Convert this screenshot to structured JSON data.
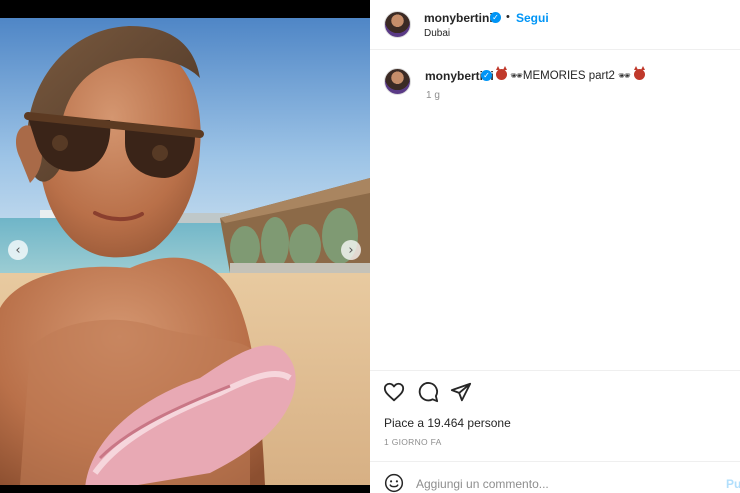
{
  "header": {
    "username": "monybertini",
    "separator": "•",
    "follow_label": "Segui",
    "location": "Dubai"
  },
  "caption": {
    "username": "monybertini",
    "text": "MEMORIES part2",
    "time_ago": "1 g"
  },
  "actions": {
    "likes_text": "Piace a 19.464 persone",
    "date_text": "1 GIORNO FA"
  },
  "comment_box": {
    "placeholder": "Aggiungi un commento...",
    "publish_label": "Pu"
  },
  "carousel": {
    "prev_glyph": "‹",
    "next_glyph": "›"
  },
  "icons": {
    "verified": "verified-badge-icon",
    "like": "heart-icon",
    "comment": "speech-bubble-icon",
    "share": "paper-plane-icon",
    "emoji": "smiley-icon"
  },
  "colors": {
    "accent": "#0095f6",
    "text": "#262626",
    "muted": "#8e8e8e",
    "divider": "#efefef"
  }
}
